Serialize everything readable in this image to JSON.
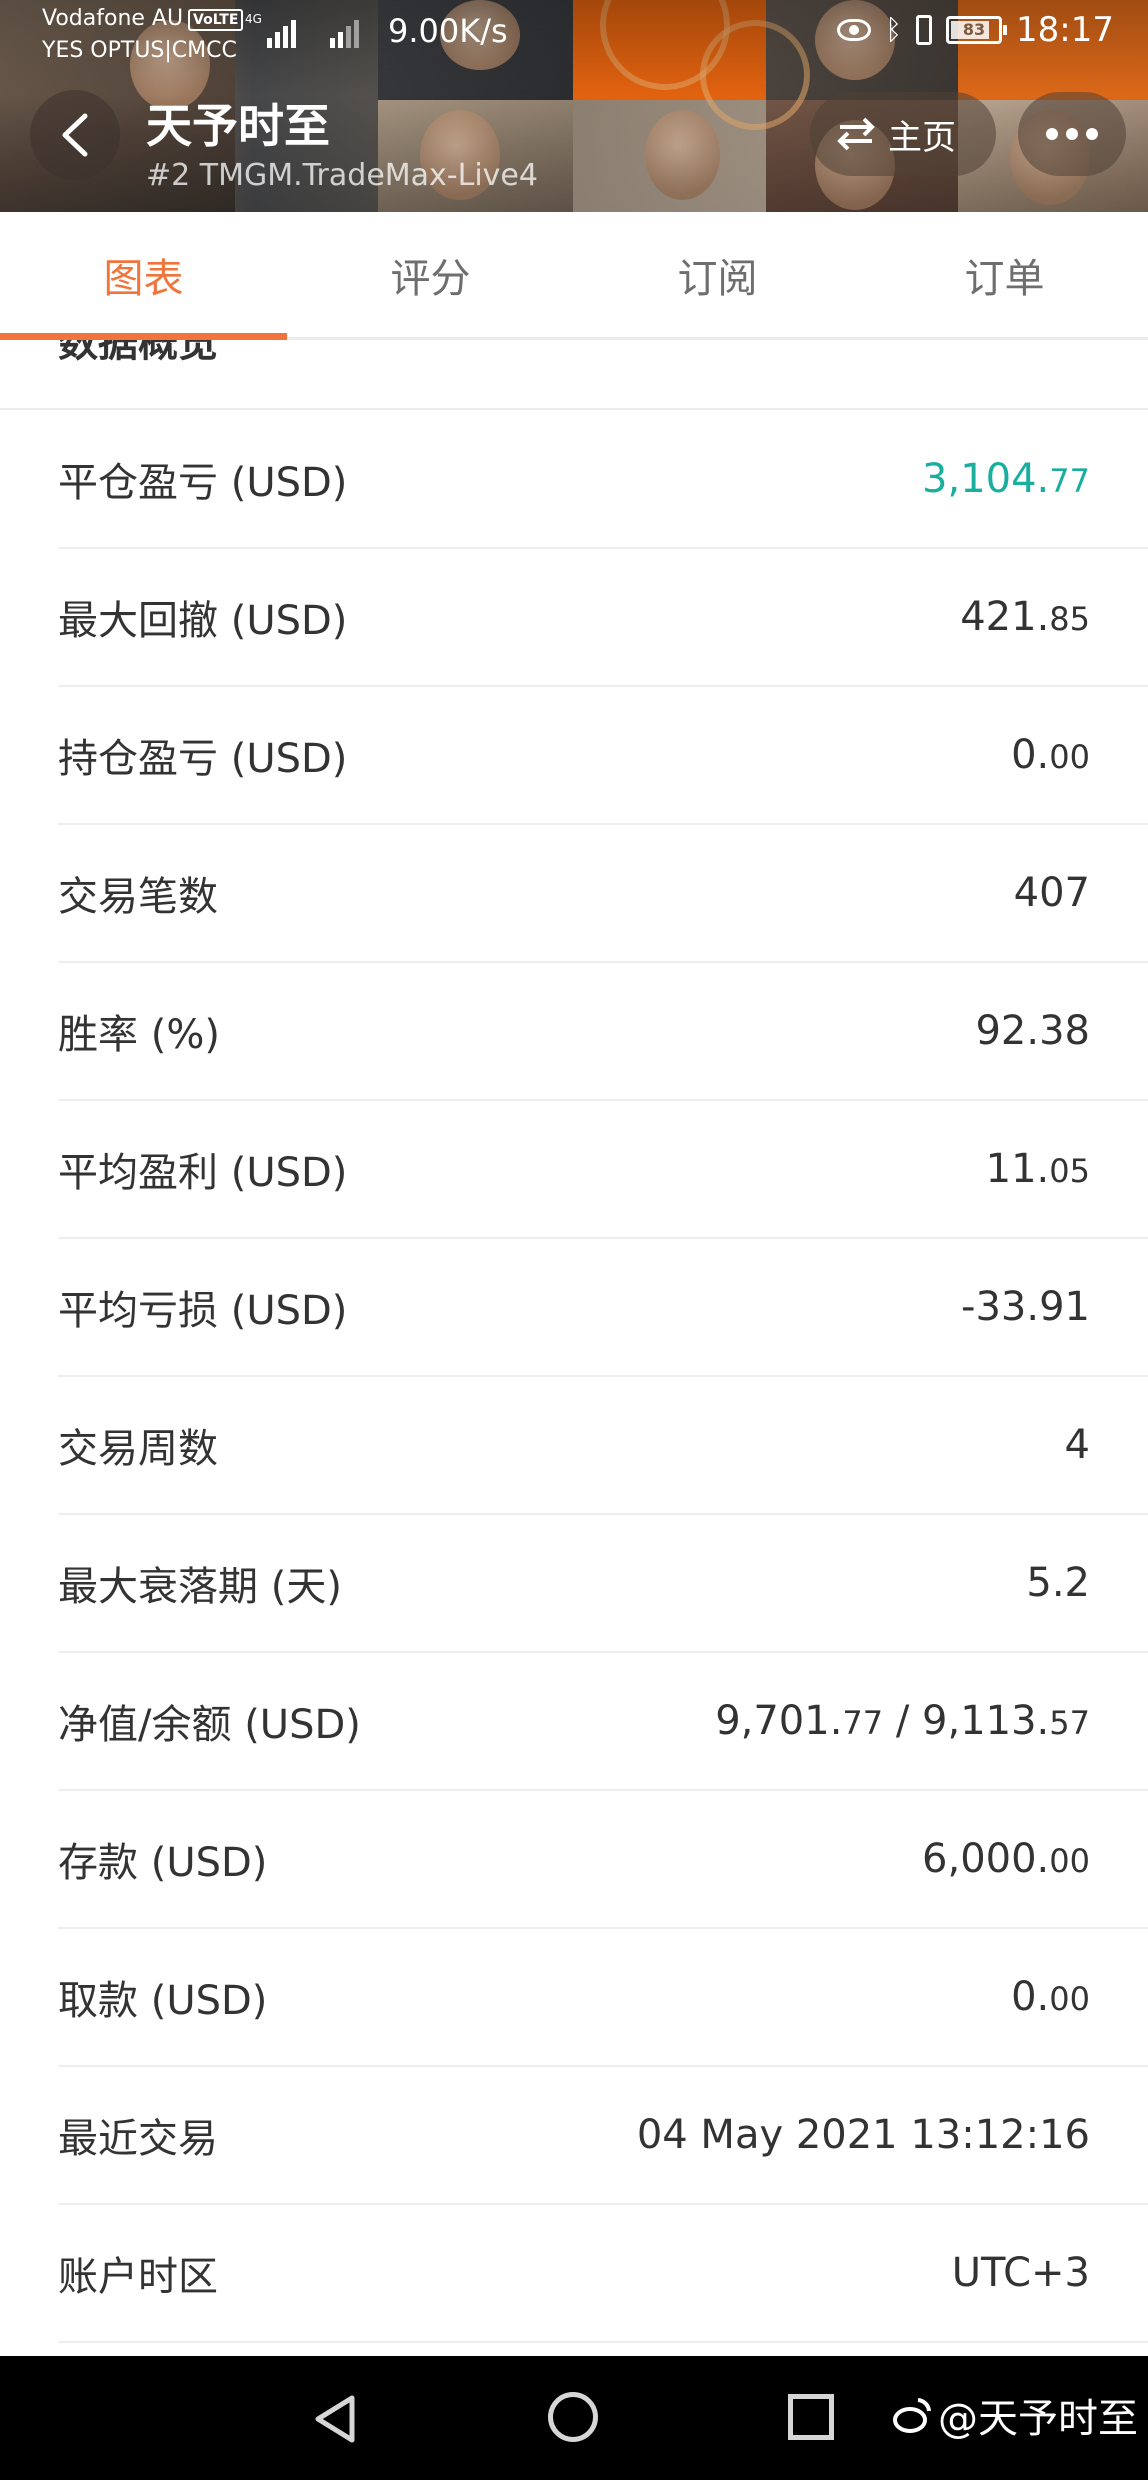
{
  "status_bar": {
    "carrier_line1": "Vodafone AU",
    "carrier_line2": "YES OPTUS|CMCC",
    "volte_badge": "VoLTE",
    "network_type": "4G",
    "net_speed": "9.00K/s",
    "battery_level": "83",
    "time": "18:17",
    "icons": [
      "eye-icon",
      "bluetooth-icon",
      "vibrate-icon",
      "battery-icon"
    ]
  },
  "header": {
    "title": "天予时至",
    "subtitle": "#2   TMGM.TradeMax-Live4",
    "home_label": "主页",
    "icons": [
      "back-icon",
      "switch-icon",
      "more-icon"
    ]
  },
  "tabs": [
    {
      "label": "图表",
      "active": true
    },
    {
      "label": "评分",
      "active": false
    },
    {
      "label": "订阅",
      "active": false
    },
    {
      "label": "订单",
      "active": false
    }
  ],
  "section": {
    "title": "数据概览"
  },
  "stats": [
    {
      "label": "平仓盈亏 (USD)",
      "value_main": "3,104.",
      "value_small": "77",
      "value_suffix": "",
      "highlight": true
    },
    {
      "label": "最大回撤 (USD)",
      "value_main": "421.",
      "value_small": "85",
      "value_suffix": "",
      "highlight": false
    },
    {
      "label": "持仓盈亏 (USD)",
      "value_main": "0.",
      "value_small": "00",
      "value_suffix": "",
      "highlight": false
    },
    {
      "label": "交易笔数",
      "value_main": "407",
      "value_small": "",
      "value_suffix": "",
      "highlight": false
    },
    {
      "label": "胜率 (%)",
      "value_main": "92.38",
      "value_small": "",
      "value_suffix": "",
      "highlight": false
    },
    {
      "label": "平均盈利 (USD)",
      "value_main": "11.",
      "value_small": "05",
      "value_suffix": "",
      "highlight": false
    },
    {
      "label": "平均亏损 (USD)",
      "value_main": "-33.91",
      "value_small": "",
      "value_suffix": "",
      "highlight": false
    },
    {
      "label": "交易周数",
      "value_main": "4",
      "value_small": "",
      "value_suffix": "",
      "highlight": false
    },
    {
      "label": "最大衰落期 (天)",
      "value_main": "5.2",
      "value_small": "",
      "value_suffix": "",
      "highlight": false
    },
    {
      "label": "净值/余额 (USD)",
      "value_main": "9,701.",
      "value_small": "77",
      "value_suffix": " / 9,113.",
      "value_small2": "57",
      "highlight": false
    },
    {
      "label": "存款 (USD)",
      "value_main": "6,000.",
      "value_small": "00",
      "value_suffix": "",
      "highlight": false
    },
    {
      "label": "取款 (USD)",
      "value_main": "0.",
      "value_small": "00",
      "value_suffix": "",
      "highlight": false
    },
    {
      "label": "最近交易",
      "value_main": "04 May 2021 13:12:16",
      "value_small": "",
      "value_suffix": "",
      "highlight": false
    },
    {
      "label": "账户时区",
      "value_main": "UTC+3",
      "value_small": "",
      "value_suffix": "",
      "highlight": false
    }
  ],
  "system_nav": {
    "watermark": "@天予时至",
    "icons": [
      "nav-back-icon",
      "nav-home-icon",
      "nav-recents-icon",
      "weibo-logo-icon"
    ]
  },
  "colors": {
    "accent": "#f0743c",
    "profit_green": "#1aae9f",
    "text": "#333333",
    "tab_inactive": "#6e6e6e"
  }
}
